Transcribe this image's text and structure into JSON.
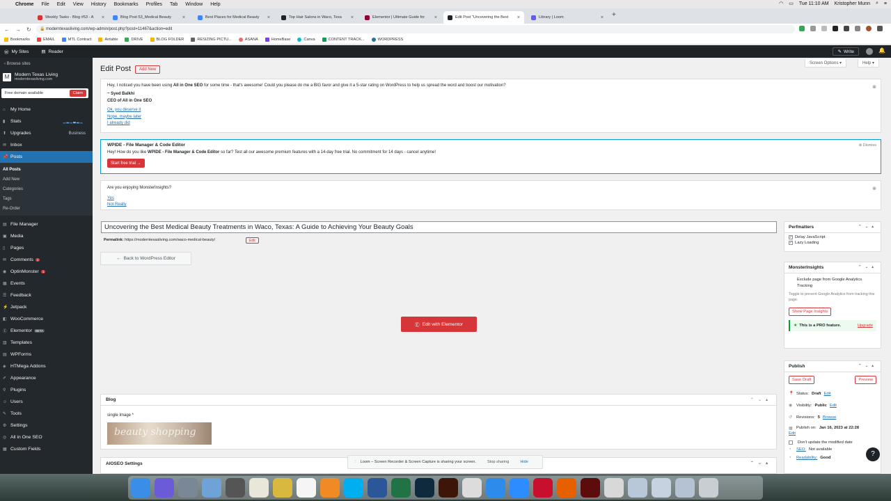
{
  "menubar": {
    "apple": "",
    "items": [
      "Chrome",
      "File",
      "Edit",
      "View",
      "History",
      "Bookmarks",
      "Profiles",
      "Tab",
      "Window",
      "Help"
    ],
    "clock": "Tue 11:10 AM",
    "user": "Kristopher Munn"
  },
  "tabs": [
    {
      "title": "Weekly Tasks - Blog #53 - A",
      "color": "#d63638"
    },
    {
      "title": "Blog Post 53_Medical Beauty",
      "color": "#4285f4"
    },
    {
      "title": "Best Places for Medical Beauty",
      "color": "#4285f4"
    },
    {
      "title": "Top Hair Salons in Waco, Texa",
      "color": "#1d2327"
    },
    {
      "title": "Elementor | Ultimate Guide for",
      "color": "#92003b"
    },
    {
      "title": "Edit Post \"Uncovering the Best",
      "color": "#1d2327"
    },
    {
      "title": "Library | Loom",
      "color": "#625df5"
    }
  ],
  "address": {
    "url": "moderntexasliving.com/wp-admin/post.php?post=11467&action=edit"
  },
  "bookmarks": [
    "Bookmarks",
    "EMAIL",
    "MTL Contract",
    "Airtable",
    "DRIVE",
    "BLOG FOLDER",
    "RESIZING PICTU...",
    "ASANA",
    "HomeBase",
    "Canva",
    "CONTENT TRACK...",
    "WORDPRESS"
  ],
  "wpbar": {
    "mysites": "My Sites",
    "reader": "Reader",
    "write": "Write"
  },
  "sidebar": {
    "browse": "Browse sites",
    "site_name": "Modern Texas Living",
    "site_url": "moderntexasliving.com",
    "free_domain": "Free domain available",
    "claim": "Claim",
    "top_items": [
      {
        "label": "My Home"
      },
      {
        "label": "Stats"
      },
      {
        "label": "Upgrades",
        "extra": "Business"
      },
      {
        "label": "Inbox"
      },
      {
        "label": "Posts"
      }
    ],
    "post_sub": [
      "All Posts",
      "Add New",
      "Categories",
      "Tags",
      "Re-Order"
    ],
    "items": [
      {
        "label": "File Manager"
      },
      {
        "label": "Media"
      },
      {
        "label": "Pages"
      },
      {
        "label": "Comments",
        "badge": "1"
      },
      {
        "label": "OptinMonster",
        "badge": "1"
      },
      {
        "label": "Events"
      },
      {
        "label": "Feedback"
      },
      {
        "label": "Jetpack"
      },
      {
        "label": "WooCommerce"
      },
      {
        "label": "Elementor",
        "badge": "BETA"
      },
      {
        "label": "Templates"
      },
      {
        "label": "WPForms"
      },
      {
        "label": "HTMega Addons"
      },
      {
        "label": "Appearance"
      },
      {
        "label": "Plugins"
      },
      {
        "label": "Users"
      },
      {
        "label": "Tools"
      },
      {
        "label": "Settings"
      },
      {
        "label": "All in One SEO"
      },
      {
        "label": "Custom Fields"
      }
    ]
  },
  "page": {
    "title": "Edit Post",
    "add_new": "Add New",
    "screen_options": "Screen Options ▾",
    "help": "Help ▾"
  },
  "notice1": {
    "text_pre": "Hey, I noticed you have been using ",
    "text_bold": "All in One SEO",
    "text_post": " for some time - that's awesome! Could you please do me a BIG favor and give it a 5-star rating on WordPress to help us spread the word and boost our motivation?",
    "sig_name": "~ Syed Balkhi",
    "sig_title": "CEO of All in One SEO",
    "link1": "Ok, you deserve it",
    "link2": "Nope, maybe later",
    "link3": "I already did"
  },
  "notice2": {
    "title": "WPIDE - File Manager & Code Editor",
    "dismiss": "Dismiss",
    "text_pre": "Hey! How do you like ",
    "text_bold": "WPIDE - File Manager & Code Editor",
    "text_post": " so far? Test all our awesome premium features with a 14-day free trial. No commitment for 14 days - cancel anytime!",
    "button": "Start free trial →"
  },
  "notice3": {
    "question": "Are you enjoying MonsterInsights?",
    "yes": "Yes",
    "no": "Not Really"
  },
  "post": {
    "title": "Uncovering the Best Medical Beauty Treatments in Waco, Texas: A Guide to Achieving Your Beauty Goals",
    "permalink_label": "Permalink:",
    "permalink_url": "https://moderntexasliving.com/waco-medical-beauty/",
    "edit": "Edit",
    "back": "Back to WordPress Editor",
    "elementor": "Edit with Elementor"
  },
  "blog": {
    "title": "Blog",
    "image_label": "single Image *",
    "image_text": "beauty shopping"
  },
  "aioseo": {
    "title": "AIOSEO Settings"
  },
  "perfmatters": {
    "title": "Perfmatters",
    "opt1": "Delay JavaScript",
    "opt2": "Lazy Loading"
  },
  "monsterinsights": {
    "title": "MonsterInsights",
    "exclude": "Exclude page from Google Analytics Tracking",
    "toggle_text": "Toggle to prevent Google Analytics from tracking this page.",
    "show_insights": "Show Page Insights",
    "pro": "This is a PRO feature.",
    "upgrade": "Upgrade"
  },
  "publish": {
    "title": "Publish",
    "save_draft": "Save Draft",
    "preview": "Preview",
    "status_label": "Status:",
    "status_value": "Draft",
    "status_edit": "Edit",
    "visibility_label": "Visibility:",
    "visibility_value": "Public",
    "visibility_edit": "Edit",
    "revisions_label": "Revisions:",
    "revisions_value": "5",
    "revisions_browse": "Browse",
    "publish_label": "Publish on:",
    "publish_value": "Jan 16, 2023 at 22:28",
    "publish_edit": "Edit",
    "dont_update": "Don't update the modified date",
    "seo_label": "SEO:",
    "seo_value": "Not available",
    "readability_label": "Readability:",
    "readability_value": "Good"
  },
  "loom": {
    "text": "Loom – Screen Recorder & Screen Capture is sharing your screen.",
    "stop": "Stop sharing",
    "hide": "Hide"
  },
  "dock": [
    {
      "name": "finder",
      "color": "#3a8ee6"
    },
    {
      "name": "siri",
      "color": "#6b5bd6"
    },
    {
      "name": "launchpad",
      "color": "#7a8796"
    },
    {
      "name": "preview",
      "color": "#6fa3d8"
    },
    {
      "name": "calculator",
      "color": "#555"
    },
    {
      "name": "notes",
      "color": "#e9e6da"
    },
    {
      "name": "stickies",
      "color": "#d9b840"
    },
    {
      "name": "calendar",
      "color": "#f5f5f5"
    },
    {
      "name": "books",
      "color": "#f08a24"
    },
    {
      "name": "skype",
      "color": "#00aff0"
    },
    {
      "name": "word",
      "color": "#2b579a"
    },
    {
      "name": "excel",
      "color": "#217346"
    },
    {
      "name": "lightroom",
      "color": "#0f2a3c"
    },
    {
      "name": "bridge",
      "color": "#3d1608"
    },
    {
      "name": "chrome",
      "color": "#dcdcdc"
    },
    {
      "name": "appstore",
      "color": "#2d8ceb"
    },
    {
      "name": "zoom",
      "color": "#2d8cff"
    },
    {
      "name": "acrobat",
      "color": "#c8102e"
    },
    {
      "name": "firefox",
      "color": "#e66000"
    },
    {
      "name": "flash",
      "color": "#5d0c0c"
    },
    {
      "name": "pdf",
      "color": "#d8d8d8"
    },
    {
      "name": "folder1",
      "color": "#b9c8d8"
    },
    {
      "name": "folder2",
      "color": "#c6d2df"
    },
    {
      "name": "folder3",
      "color": "#b4c2d2"
    },
    {
      "name": "trash",
      "color": "#c9ced3"
    }
  ]
}
